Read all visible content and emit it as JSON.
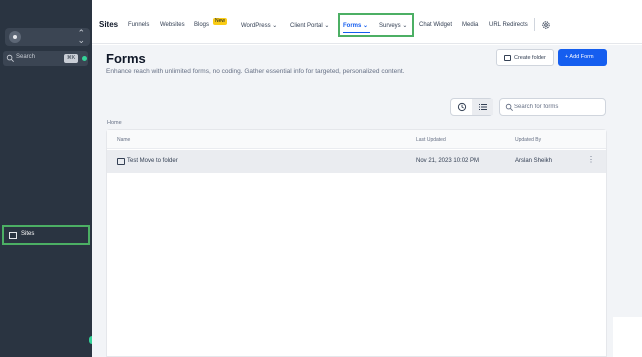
{
  "sidebar": {
    "search_placeholder": "Search",
    "search_shortcut": "⌘K",
    "sites_label": "Sites",
    "account_icon": "user-circle-icon",
    "sites_icon": "sites-icon"
  },
  "topnav": {
    "title": "Sites",
    "items": [
      {
        "label": "Funnels"
      },
      {
        "label": "Websites"
      },
      {
        "label": "Blogs"
      },
      {
        "label": "WordPress"
      },
      {
        "label": "Client Portal"
      },
      {
        "label": "Forms"
      },
      {
        "label": "Surveys"
      },
      {
        "label": "Chat Widget"
      },
      {
        "label": "Media"
      },
      {
        "label": "URL Redirects"
      }
    ],
    "blogs_badge": "New",
    "settings_icon": "gear-icon",
    "active_color": "#155eef"
  },
  "page": {
    "title": "Forms",
    "subtitle": "Enhance reach with unlimited forms, no coding. Gather essential info for targeted, personalized content.",
    "create_folder_label": "Create folder",
    "add_form_label": "+ Add Form",
    "search_placeholder": "Search for forms",
    "breadcrumb": "Home"
  },
  "table": {
    "columns": [
      "Name",
      "Last Updated",
      "Updated By"
    ],
    "rows": [
      {
        "name": "Test Move to folder",
        "last_updated": "Nov 21, 2023 10:02 PM",
        "updated_by": "Arslan Sheikh"
      }
    ]
  },
  "colors": {
    "sidebar_bg": "#2a3441",
    "primary": "#155eef",
    "highlight": "#4caf64"
  }
}
